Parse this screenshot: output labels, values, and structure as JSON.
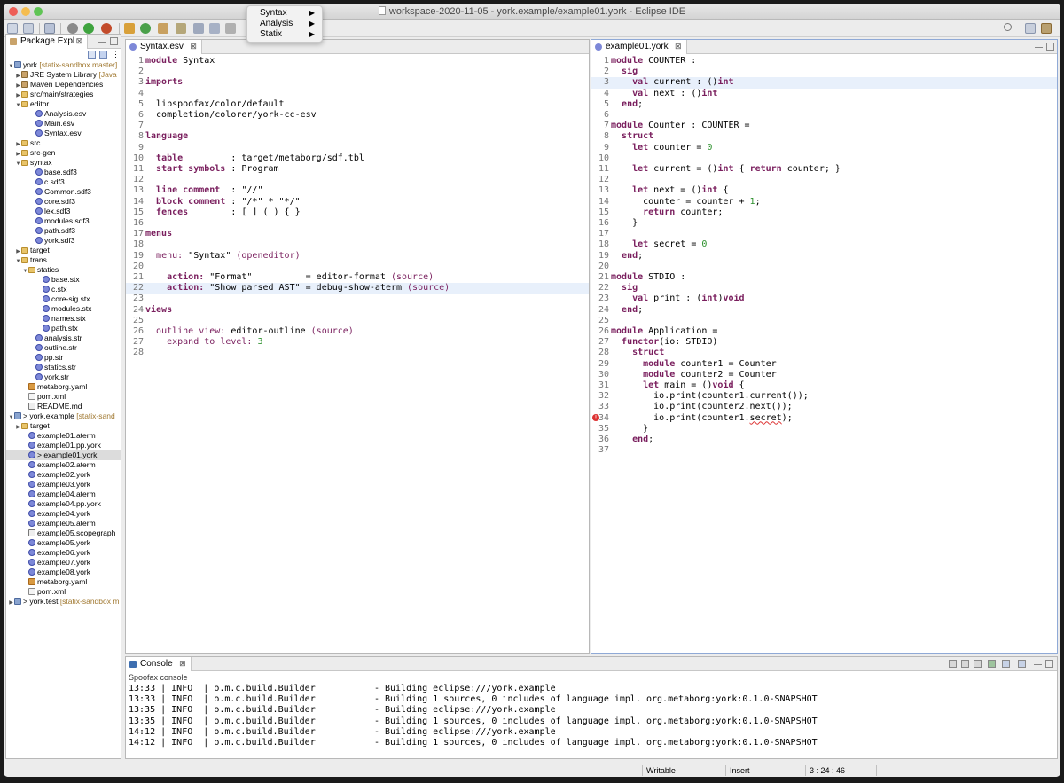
{
  "window": {
    "title": "workspace-2020-11-05 - york.example/example01.york - Eclipse IDE"
  },
  "menu_popup": {
    "items": [
      "Syntax",
      "Analysis",
      "Statix"
    ]
  },
  "package_explorer": {
    "tab_label": "Package Expl",
    "items": [
      {
        "label": "york",
        "decoration": " [statix-sandbox master]",
        "icon": "proj",
        "indent": 0,
        "twisty": "open"
      },
      {
        "label": "JRE System Library",
        "decoration": " [Java",
        "icon": "lib",
        "indent": 1,
        "twisty": "closed"
      },
      {
        "label": "Maven Dependencies",
        "decoration": "",
        "icon": "lib",
        "indent": 1,
        "twisty": "closed"
      },
      {
        "label": "src/main/strategies",
        "decoration": "",
        "icon": "folder",
        "indent": 1,
        "twisty": "closed"
      },
      {
        "label": "editor",
        "decoration": "",
        "icon": "folder",
        "indent": 1,
        "twisty": "open"
      },
      {
        "label": "Analysis.esv",
        "decoration": "",
        "icon": "file",
        "indent": 3,
        "twisty": ""
      },
      {
        "label": "Main.esv",
        "decoration": "",
        "icon": "file",
        "indent": 3,
        "twisty": ""
      },
      {
        "label": "Syntax.esv",
        "decoration": "",
        "icon": "file",
        "indent": 3,
        "twisty": ""
      },
      {
        "label": "src",
        "decoration": "",
        "icon": "folder",
        "indent": 1,
        "twisty": "closed"
      },
      {
        "label": "src-gen",
        "decoration": "",
        "icon": "folder",
        "indent": 1,
        "twisty": "closed"
      },
      {
        "label": "syntax",
        "decoration": "",
        "icon": "folder",
        "indent": 1,
        "twisty": "open"
      },
      {
        "label": "base.sdf3",
        "decoration": "",
        "icon": "file",
        "indent": 3,
        "twisty": ""
      },
      {
        "label": "c.sdf3",
        "decoration": "",
        "icon": "file",
        "indent": 3,
        "twisty": ""
      },
      {
        "label": "Common.sdf3",
        "decoration": "",
        "icon": "file",
        "indent": 3,
        "twisty": ""
      },
      {
        "label": "core.sdf3",
        "decoration": "",
        "icon": "file",
        "indent": 3,
        "twisty": ""
      },
      {
        "label": "lex.sdf3",
        "decoration": "",
        "icon": "file",
        "indent": 3,
        "twisty": ""
      },
      {
        "label": "modules.sdf3",
        "decoration": "",
        "icon": "file",
        "indent": 3,
        "twisty": ""
      },
      {
        "label": "path.sdf3",
        "decoration": "",
        "icon": "file",
        "indent": 3,
        "twisty": ""
      },
      {
        "label": "york.sdf3",
        "decoration": "",
        "icon": "file",
        "indent": 3,
        "twisty": ""
      },
      {
        "label": "target",
        "decoration": "",
        "icon": "folder",
        "indent": 1,
        "twisty": "closed"
      },
      {
        "label": "trans",
        "decoration": "",
        "icon": "folder",
        "indent": 1,
        "twisty": "open"
      },
      {
        "label": "statics",
        "decoration": "",
        "icon": "folder",
        "indent": 2,
        "twisty": "open"
      },
      {
        "label": "base.stx",
        "decoration": "",
        "icon": "file",
        "indent": 4,
        "twisty": ""
      },
      {
        "label": "c.stx",
        "decoration": "",
        "icon": "file",
        "indent": 4,
        "twisty": ""
      },
      {
        "label": "core-sig.stx",
        "decoration": "",
        "icon": "file",
        "indent": 4,
        "twisty": ""
      },
      {
        "label": "modules.stx",
        "decoration": "",
        "icon": "file",
        "indent": 4,
        "twisty": ""
      },
      {
        "label": "names.stx",
        "decoration": "",
        "icon": "file",
        "indent": 4,
        "twisty": ""
      },
      {
        "label": "path.stx",
        "decoration": "",
        "icon": "file",
        "indent": 4,
        "twisty": ""
      },
      {
        "label": "analysis.str",
        "decoration": "",
        "icon": "file",
        "indent": 3,
        "twisty": ""
      },
      {
        "label": "outline.str",
        "decoration": "",
        "icon": "file",
        "indent": 3,
        "twisty": ""
      },
      {
        "label": "pp.str",
        "decoration": "",
        "icon": "file",
        "indent": 3,
        "twisty": ""
      },
      {
        "label": "statics.str",
        "decoration": "",
        "icon": "file",
        "indent": 3,
        "twisty": ""
      },
      {
        "label": "york.str",
        "decoration": "",
        "icon": "file",
        "indent": 3,
        "twisty": ""
      },
      {
        "label": "metaborg.yaml",
        "decoration": "",
        "icon": "y",
        "indent": 2,
        "twisty": ""
      },
      {
        "label": "pom.xml",
        "decoration": "",
        "icon": "x",
        "indent": 2,
        "twisty": ""
      },
      {
        "label": "README.md",
        "decoration": "",
        "icon": "md",
        "indent": 2,
        "twisty": ""
      },
      {
        "label": "> york.example",
        "decoration": " [statix-sand",
        "icon": "proj",
        "indent": 0,
        "twisty": "open"
      },
      {
        "label": "target",
        "decoration": "",
        "icon": "folder",
        "indent": 1,
        "twisty": "closed"
      },
      {
        "label": "example01.aterm",
        "decoration": "",
        "icon": "file",
        "indent": 2,
        "twisty": ""
      },
      {
        "label": "example01.pp.york",
        "decoration": "",
        "icon": "file",
        "indent": 2,
        "twisty": ""
      },
      {
        "label": "> example01.york",
        "decoration": "",
        "icon": "file",
        "indent": 2,
        "twisty": "",
        "selected": true
      },
      {
        "label": "example02.aterm",
        "decoration": "",
        "icon": "file",
        "indent": 2,
        "twisty": ""
      },
      {
        "label": "example02.york",
        "decoration": "",
        "icon": "file",
        "indent": 2,
        "twisty": ""
      },
      {
        "label": "example03.york",
        "decoration": "",
        "icon": "file",
        "indent": 2,
        "twisty": ""
      },
      {
        "label": "example04.aterm",
        "decoration": "",
        "icon": "file",
        "indent": 2,
        "twisty": ""
      },
      {
        "label": "example04.pp.york",
        "decoration": "",
        "icon": "file",
        "indent": 2,
        "twisty": ""
      },
      {
        "label": "example04.york",
        "decoration": "",
        "icon": "file",
        "indent": 2,
        "twisty": ""
      },
      {
        "label": "example05.aterm",
        "decoration": "",
        "icon": "file",
        "indent": 2,
        "twisty": ""
      },
      {
        "label": "example05.scopegraph",
        "decoration": "",
        "icon": "md",
        "indent": 2,
        "twisty": ""
      },
      {
        "label": "example05.york",
        "decoration": "",
        "icon": "file",
        "indent": 2,
        "twisty": ""
      },
      {
        "label": "example06.york",
        "decoration": "",
        "icon": "file",
        "indent": 2,
        "twisty": ""
      },
      {
        "label": "example07.york",
        "decoration": "",
        "icon": "file",
        "indent": 2,
        "twisty": ""
      },
      {
        "label": "example08.york",
        "decoration": "",
        "icon": "file",
        "indent": 2,
        "twisty": ""
      },
      {
        "label": "metaborg.yaml",
        "decoration": "",
        "icon": "y",
        "indent": 2,
        "twisty": ""
      },
      {
        "label": "pom.xml",
        "decoration": "",
        "icon": "x",
        "indent": 2,
        "twisty": ""
      },
      {
        "label": "> york.test",
        "decoration": " [statix-sandbox m",
        "icon": "proj",
        "indent": 0,
        "twisty": "closed"
      }
    ]
  },
  "editor_left": {
    "tab_label": "Syntax.esv",
    "highlight_line": 22,
    "lines": [
      [
        [
          "kw",
          "module"
        ],
        [
          "t",
          " Syntax"
        ]
      ],
      [],
      [
        [
          "kw",
          "imports"
        ]
      ],
      [],
      [
        [
          "t",
          "  libspoofax/color/default"
        ]
      ],
      [
        [
          "t",
          "  completion/colorer/york-cc-esv"
        ]
      ],
      [],
      [
        [
          "kw",
          "language"
        ]
      ],
      [],
      [
        [
          "t",
          "  "
        ],
        [
          "kw",
          "table"
        ],
        [
          "t",
          "         : target/metaborg/sdf.tbl"
        ]
      ],
      [
        [
          "t",
          "  "
        ],
        [
          "kw",
          "start symbols"
        ],
        [
          "t",
          " : Program"
        ]
      ],
      [],
      [
        [
          "t",
          "  "
        ],
        [
          "kw",
          "line comment"
        ],
        [
          "t",
          "  : \"//\""
        ]
      ],
      [
        [
          "t",
          "  "
        ],
        [
          "kw",
          "block comment"
        ],
        [
          "t",
          " : \"/*\" * \"*/\""
        ]
      ],
      [
        [
          "t",
          "  "
        ],
        [
          "kw",
          "fences"
        ],
        [
          "t",
          "        : [ ] ( ) { }"
        ]
      ],
      [],
      [
        [
          "kw",
          "menus"
        ]
      ],
      [],
      [
        [
          "t",
          "  "
        ],
        [
          "ann",
          "menu:"
        ],
        [
          "t",
          " \"Syntax\" "
        ],
        [
          "ann",
          "(openeditor)"
        ]
      ],
      [],
      [
        [
          "t",
          "    "
        ],
        [
          "kw",
          "action:"
        ],
        [
          "t",
          " \"Format\"          = editor-format "
        ],
        [
          "ann",
          "(source)"
        ]
      ],
      [
        [
          "t",
          "    "
        ],
        [
          "kw",
          "action:"
        ],
        [
          "t",
          " \"Show parsed AST\" = debug-show-aterm "
        ],
        [
          "ann",
          "(source)"
        ]
      ],
      [],
      [
        [
          "kw",
          "views"
        ]
      ],
      [],
      [
        [
          "t",
          "  "
        ],
        [
          "ann",
          "outline view:"
        ],
        [
          "t",
          " editor-outline "
        ],
        [
          "ann",
          "(source)"
        ]
      ],
      [
        [
          "t",
          "    "
        ],
        [
          "ann",
          "expand to level:"
        ],
        [
          "t",
          " "
        ],
        [
          "num",
          "3"
        ]
      ],
      []
    ]
  },
  "editor_right": {
    "tab_label": "example01.york",
    "highlight_line": 3,
    "error_line": 34,
    "lines": [
      [
        [
          "kw",
          "module"
        ],
        [
          "t",
          " COUNTER :"
        ]
      ],
      [
        [
          "t",
          "  "
        ],
        [
          "kw",
          "sig"
        ]
      ],
      [
        [
          "t",
          "    "
        ],
        [
          "kw",
          "val"
        ],
        [
          "t",
          " current : ()"
        ],
        [
          "kw",
          "int"
        ]
      ],
      [
        [
          "t",
          "    "
        ],
        [
          "kw",
          "val"
        ],
        [
          "t",
          " next : ()"
        ],
        [
          "kw",
          "int"
        ]
      ],
      [
        [
          "t",
          "  "
        ],
        [
          "kw",
          "end"
        ],
        [
          "t",
          ";"
        ]
      ],
      [],
      [
        [
          "kw",
          "module"
        ],
        [
          "t",
          " Counter : COUNTER ="
        ]
      ],
      [
        [
          "t",
          "  "
        ],
        [
          "kw",
          "struct"
        ]
      ],
      [
        [
          "t",
          "    "
        ],
        [
          "kw",
          "let"
        ],
        [
          "t",
          " counter = "
        ],
        [
          "num",
          "0"
        ]
      ],
      [],
      [
        [
          "t",
          "    "
        ],
        [
          "kw",
          "let"
        ],
        [
          "t",
          " current = ()"
        ],
        [
          "kw",
          "int"
        ],
        [
          "t",
          " { "
        ],
        [
          "kw",
          "return"
        ],
        [
          "t",
          " counter; }"
        ]
      ],
      [],
      [
        [
          "t",
          "    "
        ],
        [
          "kw",
          "let"
        ],
        [
          "t",
          " next = ()"
        ],
        [
          "kw",
          "int"
        ],
        [
          "t",
          " {"
        ]
      ],
      [
        [
          "t",
          "      counter = counter + "
        ],
        [
          "num",
          "1"
        ],
        [
          "t",
          ";"
        ]
      ],
      [
        [
          "t",
          "      "
        ],
        [
          "kw",
          "return"
        ],
        [
          "t",
          " counter;"
        ]
      ],
      [
        [
          "t",
          "    }"
        ]
      ],
      [],
      [
        [
          "t",
          "    "
        ],
        [
          "kw",
          "let"
        ],
        [
          "t",
          " secret = "
        ],
        [
          "num",
          "0"
        ]
      ],
      [
        [
          "t",
          "  "
        ],
        [
          "kw",
          "end"
        ],
        [
          "t",
          ";"
        ]
      ],
      [],
      [
        [
          "kw",
          "module"
        ],
        [
          "t",
          " STDIO :"
        ]
      ],
      [
        [
          "t",
          "  "
        ],
        [
          "kw",
          "sig"
        ]
      ],
      [
        [
          "t",
          "    "
        ],
        [
          "kw",
          "val"
        ],
        [
          "t",
          " print : ("
        ],
        [
          "kw",
          "int"
        ],
        [
          "t",
          ")"
        ],
        [
          "kw",
          "void"
        ]
      ],
      [
        [
          "t",
          "  "
        ],
        [
          "kw",
          "end"
        ],
        [
          "t",
          ";"
        ]
      ],
      [],
      [
        [
          "kw",
          "module"
        ],
        [
          "t",
          " Application ="
        ]
      ],
      [
        [
          "t",
          "  "
        ],
        [
          "kw",
          "functor"
        ],
        [
          "t",
          "(io: STDIO)"
        ]
      ],
      [
        [
          "t",
          "    "
        ],
        [
          "kw",
          "struct"
        ]
      ],
      [
        [
          "t",
          "      "
        ],
        [
          "kw",
          "module"
        ],
        [
          "t",
          " counter1 = Counter"
        ]
      ],
      [
        [
          "t",
          "      "
        ],
        [
          "kw",
          "module"
        ],
        [
          "t",
          " counter2 = Counter"
        ]
      ],
      [
        [
          "t",
          "      "
        ],
        [
          "kw",
          "let"
        ],
        [
          "t",
          " main = ()"
        ],
        [
          "kw",
          "void"
        ],
        [
          "t",
          " {"
        ]
      ],
      [
        [
          "t",
          "        io.print(counter1.current());"
        ]
      ],
      [
        [
          "t",
          "        io.print(counter2.next());"
        ]
      ],
      [
        [
          "t",
          "        io.print(counter1."
        ],
        [
          "err",
          "secret"
        ],
        [
          "t",
          ");"
        ]
      ],
      [
        [
          "t",
          "      }"
        ]
      ],
      [
        [
          "t",
          "    "
        ],
        [
          "kw",
          "end"
        ],
        [
          "t",
          ";"
        ]
      ],
      []
    ]
  },
  "console": {
    "tab_label": "Console",
    "subtitle": "Spoofax console",
    "lines": [
      "13:33 | INFO  | o.m.c.build.Builder           - Building eclipse:///york.example",
      "13:33 | INFO  | o.m.c.build.Builder           - Building 1 sources, 0 includes of language impl. org.metaborg:york:0.1.0-SNAPSHOT",
      "13:35 | INFO  | o.m.c.build.Builder           - Building eclipse:///york.example",
      "13:35 | INFO  | o.m.c.build.Builder           - Building 1 sources, 0 includes of language impl. org.metaborg:york:0.1.0-SNAPSHOT",
      "14:12 | INFO  | o.m.c.build.Builder           - Building eclipse:///york.example",
      "14:12 | INFO  | o.m.c.build.Builder           - Building 1 sources, 0 includes of language impl. org.metaborg:york:0.1.0-SNAPSHOT"
    ]
  },
  "status_bar": {
    "mode": "Writable",
    "insert": "Insert",
    "position": "3 : 24 : 46"
  },
  "colors": {
    "keyword": "#7a1f5e",
    "number": "#2a8f2a",
    "selection": "#dcdcdc",
    "current_line": "#e8f0fb"
  }
}
